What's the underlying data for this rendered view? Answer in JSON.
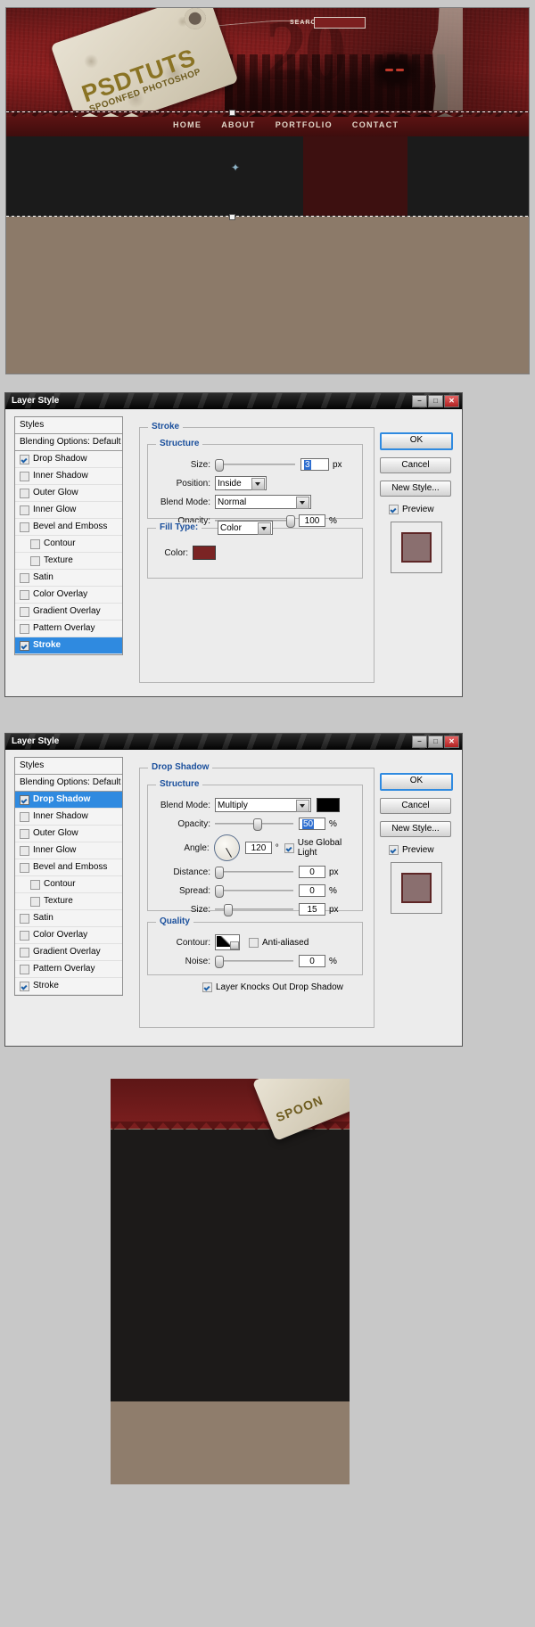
{
  "mockup": {
    "brand": "PSDTUTS",
    "tagline": "SPOONFED PHOTOSHOP",
    "search_label": "SEARCH",
    "search_value": "",
    "nav": [
      "HOME",
      "ABOUT",
      "PORTFOLIO",
      "CONTACT"
    ]
  },
  "dialog_stroke": {
    "title": "Layer Style",
    "win_buttons": {
      "minimize": "–",
      "maximize": "□",
      "close": "✕"
    },
    "styles_list": [
      {
        "label": "Styles",
        "checkbox": false,
        "checked": false,
        "selected": false,
        "indent": false
      },
      {
        "label": "Blending Options: Default",
        "checkbox": false,
        "checked": false,
        "selected": false,
        "indent": false
      },
      {
        "label": "Drop Shadow",
        "checkbox": true,
        "checked": true,
        "selected": false,
        "indent": false
      },
      {
        "label": "Inner Shadow",
        "checkbox": true,
        "checked": false,
        "selected": false,
        "indent": false
      },
      {
        "label": "Outer Glow",
        "checkbox": true,
        "checked": false,
        "selected": false,
        "indent": false
      },
      {
        "label": "Inner Glow",
        "checkbox": true,
        "checked": false,
        "selected": false,
        "indent": false
      },
      {
        "label": "Bevel and Emboss",
        "checkbox": true,
        "checked": false,
        "selected": false,
        "indent": false
      },
      {
        "label": "Contour",
        "checkbox": true,
        "checked": false,
        "selected": false,
        "indent": true
      },
      {
        "label": "Texture",
        "checkbox": true,
        "checked": false,
        "selected": false,
        "indent": true
      },
      {
        "label": "Satin",
        "checkbox": true,
        "checked": false,
        "selected": false,
        "indent": false
      },
      {
        "label": "Color Overlay",
        "checkbox": true,
        "checked": false,
        "selected": false,
        "indent": false
      },
      {
        "label": "Gradient Overlay",
        "checkbox": true,
        "checked": false,
        "selected": false,
        "indent": false
      },
      {
        "label": "Pattern Overlay",
        "checkbox": true,
        "checked": false,
        "selected": false,
        "indent": false
      },
      {
        "label": "Stroke",
        "checkbox": true,
        "checked": true,
        "selected": true,
        "indent": false
      }
    ],
    "panel_title": "Stroke",
    "structure_title": "Structure",
    "size_label": "Size:",
    "size_value": "3",
    "size_unit": "px",
    "position_label": "Position:",
    "position_value": "Inside",
    "blend_mode_label": "Blend Mode:",
    "blend_mode_value": "Normal",
    "opacity_label": "Opacity:",
    "opacity_value": "100",
    "opacity_unit": "%",
    "fill_type_label": "Fill Type:",
    "fill_type_value": "Color",
    "color_label": "Color:",
    "color_value": "#7a2424",
    "buttons": {
      "ok": "OK",
      "cancel": "Cancel",
      "new_style": "New Style..."
    },
    "preview_label": "Preview",
    "preview_checked": true
  },
  "dialog_dropshadow": {
    "title": "Layer Style",
    "win_buttons": {
      "minimize": "–",
      "maximize": "□",
      "close": "✕"
    },
    "styles_list": [
      {
        "label": "Styles",
        "checkbox": false,
        "checked": false,
        "selected": false,
        "indent": false
      },
      {
        "label": "Blending Options: Default",
        "checkbox": false,
        "checked": false,
        "selected": false,
        "indent": false
      },
      {
        "label": "Drop Shadow",
        "checkbox": true,
        "checked": true,
        "selected": true,
        "indent": false
      },
      {
        "label": "Inner Shadow",
        "checkbox": true,
        "checked": false,
        "selected": false,
        "indent": false
      },
      {
        "label": "Outer Glow",
        "checkbox": true,
        "checked": false,
        "selected": false,
        "indent": false
      },
      {
        "label": "Inner Glow",
        "checkbox": true,
        "checked": false,
        "selected": false,
        "indent": false
      },
      {
        "label": "Bevel and Emboss",
        "checkbox": true,
        "checked": false,
        "selected": false,
        "indent": false
      },
      {
        "label": "Contour",
        "checkbox": true,
        "checked": false,
        "selected": false,
        "indent": true
      },
      {
        "label": "Texture",
        "checkbox": true,
        "checked": false,
        "selected": false,
        "indent": true
      },
      {
        "label": "Satin",
        "checkbox": true,
        "checked": false,
        "selected": false,
        "indent": false
      },
      {
        "label": "Color Overlay",
        "checkbox": true,
        "checked": false,
        "selected": false,
        "indent": false
      },
      {
        "label": "Gradient Overlay",
        "checkbox": true,
        "checked": false,
        "selected": false,
        "indent": false
      },
      {
        "label": "Pattern Overlay",
        "checkbox": true,
        "checked": false,
        "selected": false,
        "indent": false
      },
      {
        "label": "Stroke",
        "checkbox": true,
        "checked": true,
        "selected": false,
        "indent": false
      }
    ],
    "panel_title": "Drop Shadow",
    "structure_title": "Structure",
    "blend_mode_label": "Blend Mode:",
    "blend_mode_value": "Multiply",
    "shadow_color": "#000000",
    "opacity_label": "Opacity:",
    "opacity_value": "50",
    "opacity_unit": "%",
    "angle_label": "Angle:",
    "angle_value": "120",
    "angle_unit": "°",
    "use_global_light_label": "Use Global Light",
    "use_global_light_checked": true,
    "distance_label": "Distance:",
    "distance_value": "0",
    "distance_unit": "px",
    "spread_label": "Spread:",
    "spread_value": "0",
    "spread_unit": "%",
    "size_label": "Size:",
    "size_value": "15",
    "size_unit": "px",
    "quality_title": "Quality",
    "contour_label": "Contour:",
    "anti_aliased_label": "Anti-aliased",
    "anti_aliased_checked": false,
    "noise_label": "Noise:",
    "noise_value": "0",
    "noise_unit": "%",
    "knocks_out_label": "Layer Knocks Out Drop Shadow",
    "knocks_out_checked": true,
    "buttons": {
      "ok": "OK",
      "cancel": "Cancel",
      "new_style": "New Style..."
    },
    "preview_label": "Preview",
    "preview_checked": true
  },
  "bottom_preview": {
    "tag_text": "SPOON"
  }
}
